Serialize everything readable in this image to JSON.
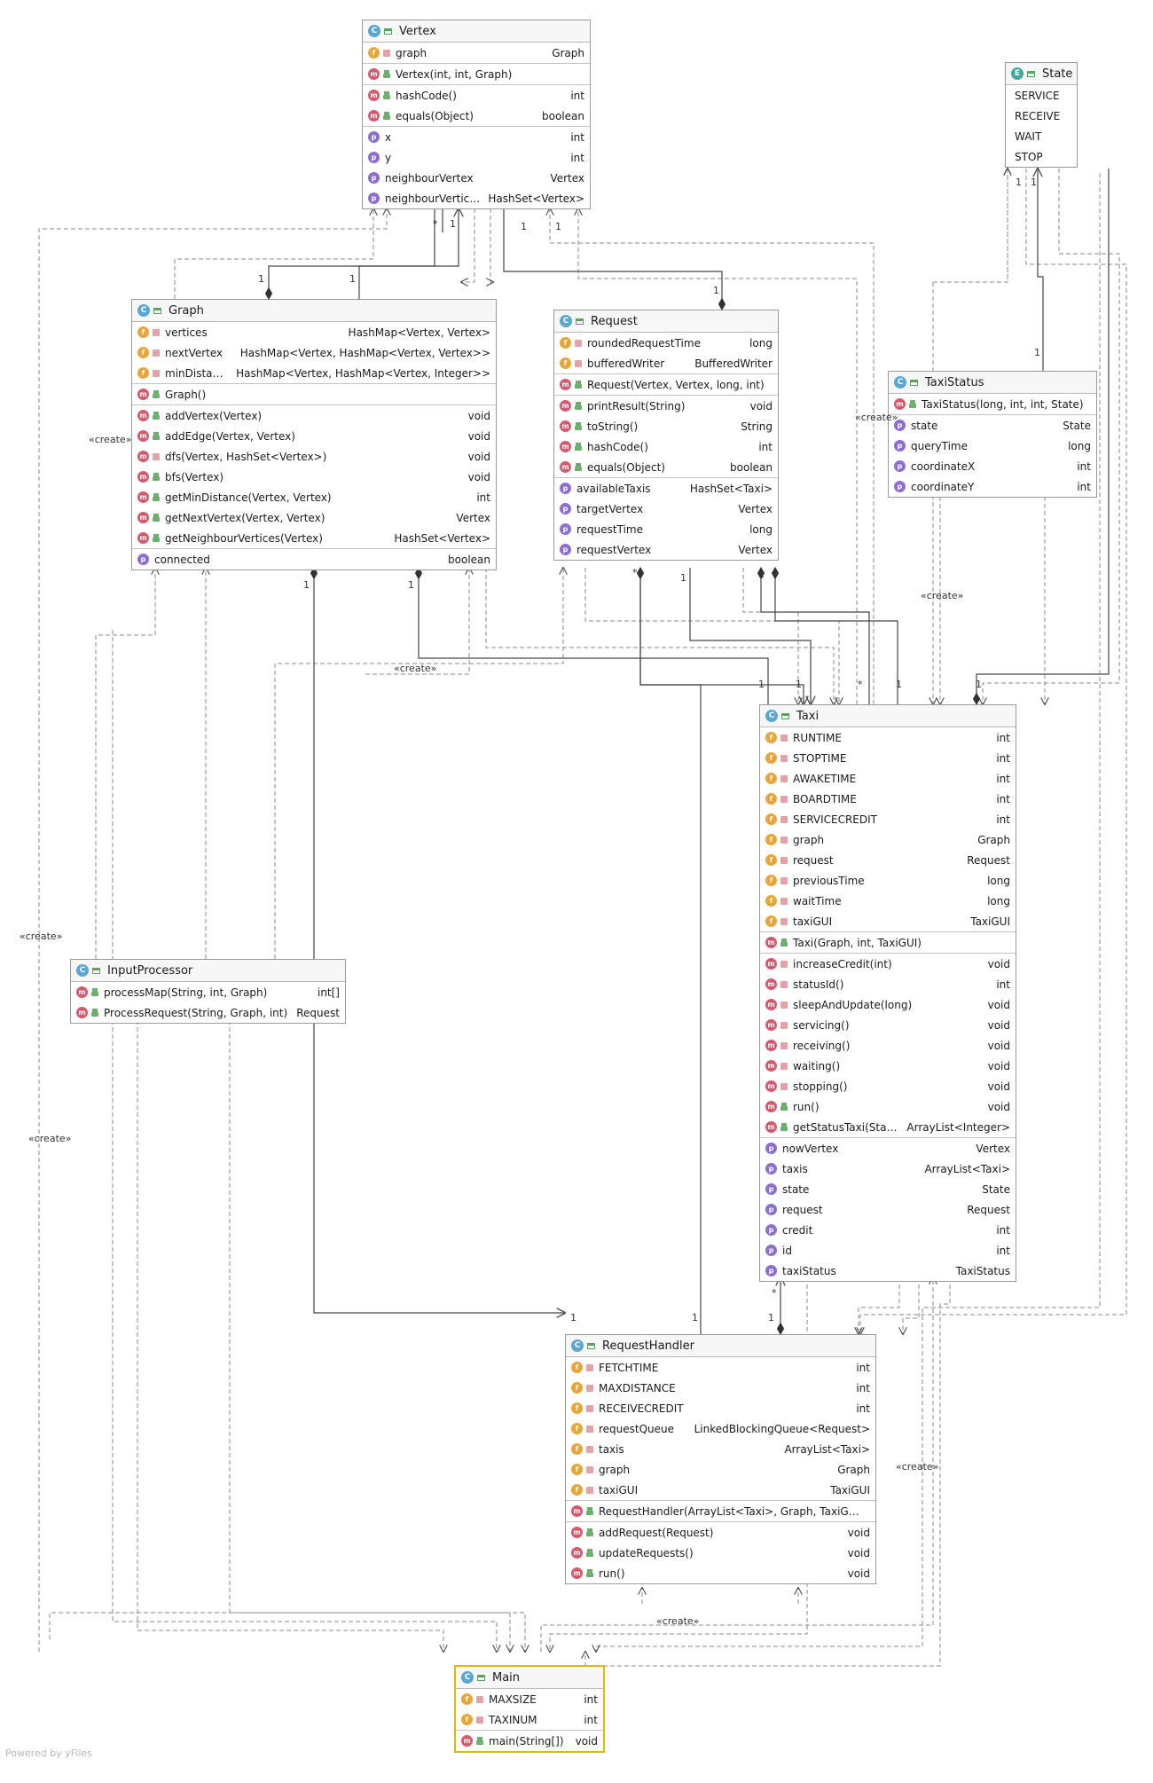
{
  "footer": "Powered by yFiles",
  "stereotype": "«create»",
  "mult_one": "1",
  "mult_many": "*",
  "classes": {
    "vertex": {
      "badge": "C",
      "name": "Vertex",
      "sections": [
        [
          {
            "k": "f",
            "v": "priv",
            "n": "graph",
            "t": "Graph"
          }
        ],
        [
          {
            "k": "m",
            "v": "pub",
            "n": "Vertex(int, int, Graph)",
            "t": ""
          }
        ],
        [
          {
            "k": "m",
            "v": "pub",
            "n": "hashCode()",
            "t": "int"
          },
          {
            "k": "m",
            "v": "pub",
            "n": "equals(Object)",
            "t": "boolean"
          }
        ],
        [
          {
            "k": "p",
            "v": "none",
            "n": "x",
            "t": "int"
          },
          {
            "k": "p",
            "v": "none",
            "n": "y",
            "t": "int"
          },
          {
            "k": "p",
            "v": "none",
            "n": "neighbourVertex",
            "t": "Vertex"
          },
          {
            "k": "p",
            "v": "none",
            "n": "neighbourVertices",
            "t": "HashSet<Vertex>"
          }
        ]
      ]
    },
    "state": {
      "badge": "E",
      "name": "State",
      "sections": [
        [
          {
            "k": "",
            "v": "",
            "n": "SERVICE",
            "t": ""
          },
          {
            "k": "",
            "v": "",
            "n": "RECEIVE",
            "t": ""
          },
          {
            "k": "",
            "v": "",
            "n": "WAIT",
            "t": ""
          },
          {
            "k": "",
            "v": "",
            "n": "STOP",
            "t": ""
          }
        ]
      ]
    },
    "graph": {
      "badge": "C",
      "name": "Graph",
      "sections": [
        [
          {
            "k": "f",
            "v": "priv",
            "n": "vertices",
            "t": "HashMap<Vertex, Vertex>"
          },
          {
            "k": "f",
            "v": "priv",
            "n": "nextVertex",
            "t": "HashMap<Vertex, HashMap<Vertex, Vertex>>"
          },
          {
            "k": "f",
            "v": "priv",
            "n": "minDistance",
            "t": "HashMap<Vertex, HashMap<Vertex, Integer>>"
          }
        ],
        [
          {
            "k": "m",
            "v": "pub",
            "n": "Graph()",
            "t": ""
          }
        ],
        [
          {
            "k": "m",
            "v": "pub",
            "n": "addVertex(Vertex)",
            "t": "void"
          },
          {
            "k": "m",
            "v": "pub",
            "n": "addEdge(Vertex, Vertex)",
            "t": "void"
          },
          {
            "k": "m",
            "v": "priv",
            "n": "dfs(Vertex, HashSet<Vertex>)",
            "t": "void"
          },
          {
            "k": "m",
            "v": "pub",
            "n": "bfs(Vertex)",
            "t": "void"
          },
          {
            "k": "m",
            "v": "pub",
            "n": "getMinDistance(Vertex, Vertex)",
            "t": "int"
          },
          {
            "k": "m",
            "v": "pub",
            "n": "getNextVertex(Vertex, Vertex)",
            "t": "Vertex"
          },
          {
            "k": "m",
            "v": "pub",
            "n": "getNeighbourVertices(Vertex)",
            "t": "HashSet<Vertex>"
          }
        ],
        [
          {
            "k": "p",
            "v": "none",
            "n": "connected",
            "t": "boolean"
          }
        ]
      ]
    },
    "request": {
      "badge": "C",
      "name": "Request",
      "sections": [
        [
          {
            "k": "f",
            "v": "priv",
            "n": "roundedRequestTime",
            "t": "long"
          },
          {
            "k": "f",
            "v": "priv",
            "n": "bufferedWriter",
            "t": "BufferedWriter"
          }
        ],
        [
          {
            "k": "m",
            "v": "pub",
            "n": "Request(Vertex, Vertex, long, int)",
            "t": ""
          }
        ],
        [
          {
            "k": "m",
            "v": "pub",
            "n": "printResult(String)",
            "t": "void"
          },
          {
            "k": "m",
            "v": "pub",
            "n": "toString()",
            "t": "String"
          },
          {
            "k": "m",
            "v": "pub",
            "n": "hashCode()",
            "t": "int"
          },
          {
            "k": "m",
            "v": "pub",
            "n": "equals(Object)",
            "t": "boolean"
          }
        ],
        [
          {
            "k": "p",
            "v": "none",
            "n": "availableTaxis",
            "t": "HashSet<Taxi>"
          },
          {
            "k": "p",
            "v": "none",
            "n": "targetVertex",
            "t": "Vertex"
          },
          {
            "k": "p",
            "v": "none",
            "n": "requestTime",
            "t": "long"
          },
          {
            "k": "p",
            "v": "none",
            "n": "requestVertex",
            "t": "Vertex"
          }
        ]
      ]
    },
    "taxistatus": {
      "badge": "C",
      "name": "TaxiStatus",
      "sections": [
        [
          {
            "k": "m",
            "v": "pub",
            "n": "TaxiStatus(long, int, int, State)",
            "t": ""
          }
        ],
        [
          {
            "k": "p",
            "v": "none",
            "n": "state",
            "t": "State"
          },
          {
            "k": "p",
            "v": "none",
            "n": "queryTime",
            "t": "long"
          },
          {
            "k": "p",
            "v": "none",
            "n": "coordinateX",
            "t": "int"
          },
          {
            "k": "p",
            "v": "none",
            "n": "coordinateY",
            "t": "int"
          }
        ]
      ]
    },
    "taxi": {
      "badge": "C",
      "name": "Taxi",
      "sections": [
        [
          {
            "k": "f",
            "v": "priv",
            "n": "RUNTIME",
            "t": "int"
          },
          {
            "k": "f",
            "v": "priv",
            "n": "STOPTIME",
            "t": "int"
          },
          {
            "k": "f",
            "v": "priv",
            "n": "AWAKETIME",
            "t": "int"
          },
          {
            "k": "f",
            "v": "priv",
            "n": "BOARDTIME",
            "t": "int"
          },
          {
            "k": "f",
            "v": "priv",
            "n": "SERVICECREDIT",
            "t": "int"
          },
          {
            "k": "f",
            "v": "priv",
            "n": "graph",
            "t": "Graph"
          },
          {
            "k": "f",
            "v": "priv",
            "n": "request",
            "t": "Request"
          },
          {
            "k": "f",
            "v": "priv",
            "n": "previousTime",
            "t": "long"
          },
          {
            "k": "f",
            "v": "priv",
            "n": "waitTime",
            "t": "long"
          },
          {
            "k": "f",
            "v": "priv",
            "n": "taxiGUI",
            "t": "TaxiGUI"
          }
        ],
        [
          {
            "k": "m",
            "v": "pub",
            "n": "Taxi(Graph, int, TaxiGUI)",
            "t": ""
          }
        ],
        [
          {
            "k": "m",
            "v": "priv",
            "n": "increaseCredit(int)",
            "t": "void"
          },
          {
            "k": "m",
            "v": "priv",
            "n": "statusId()",
            "t": "int"
          },
          {
            "k": "m",
            "v": "priv",
            "n": "sleepAndUpdate(long)",
            "t": "void"
          },
          {
            "k": "m",
            "v": "priv",
            "n": "servicing()",
            "t": "void"
          },
          {
            "k": "m",
            "v": "priv",
            "n": "receiving()",
            "t": "void"
          },
          {
            "k": "m",
            "v": "priv",
            "n": "waiting()",
            "t": "void"
          },
          {
            "k": "m",
            "v": "priv",
            "n": "stopping()",
            "t": "void"
          },
          {
            "k": "m",
            "v": "pub",
            "n": "run()",
            "t": "void"
          },
          {
            "k": "m",
            "v": "pub",
            "n": "getStatusTaxi(State)",
            "t": "ArrayList<Integer>"
          }
        ],
        [
          {
            "k": "p",
            "v": "none",
            "n": "nowVertex",
            "t": "Vertex"
          },
          {
            "k": "p",
            "v": "none",
            "n": "taxis",
            "t": "ArrayList<Taxi>"
          },
          {
            "k": "p",
            "v": "none",
            "n": "state",
            "t": "State"
          },
          {
            "k": "p",
            "v": "none",
            "n": "request",
            "t": "Request"
          },
          {
            "k": "p",
            "v": "none",
            "n": "credit",
            "t": "int"
          },
          {
            "k": "p",
            "v": "none",
            "n": "id",
            "t": "int"
          },
          {
            "k": "p",
            "v": "none",
            "n": "taxiStatus",
            "t": "TaxiStatus"
          }
        ]
      ]
    },
    "inputprocessor": {
      "badge": "C",
      "name": "InputProcessor",
      "sections": [
        [
          {
            "k": "m",
            "v": "pub",
            "n": "processMap(String, int, Graph)",
            "t": "int[]"
          },
          {
            "k": "m",
            "v": "pub",
            "n": "ProcessRequest(String, Graph, int)",
            "t": "Request"
          }
        ]
      ]
    },
    "requesthandler": {
      "badge": "C",
      "name": "RequestHandler",
      "sections": [
        [
          {
            "k": "f",
            "v": "priv",
            "n": "FETCHTIME",
            "t": "int"
          },
          {
            "k": "f",
            "v": "priv",
            "n": "MAXDISTANCE",
            "t": "int"
          },
          {
            "k": "f",
            "v": "priv",
            "n": "RECEIVECREDIT",
            "t": "int"
          },
          {
            "k": "f",
            "v": "priv",
            "n": "requestQueue",
            "t": "LinkedBlockingQueue<Request>"
          },
          {
            "k": "f",
            "v": "priv",
            "n": "taxis",
            "t": "ArrayList<Taxi>"
          },
          {
            "k": "f",
            "v": "priv",
            "n": "graph",
            "t": "Graph"
          },
          {
            "k": "f",
            "v": "priv",
            "n": "taxiGUI",
            "t": "TaxiGUI"
          }
        ],
        [
          {
            "k": "m",
            "v": "pub",
            "n": "RequestHandler(ArrayList<Taxi>, Graph, TaxiGUI)",
            "t": ""
          }
        ],
        [
          {
            "k": "m",
            "v": "pub",
            "n": "addRequest(Request)",
            "t": "void"
          },
          {
            "k": "m",
            "v": "pub",
            "n": "updateRequests()",
            "t": "void"
          },
          {
            "k": "m",
            "v": "pub",
            "n": "run()",
            "t": "void"
          }
        ]
      ]
    },
    "main": {
      "badge": "C",
      "name": "Main",
      "sections": [
        [
          {
            "k": "f",
            "v": "priv",
            "n": "MAXSIZE",
            "t": "int"
          },
          {
            "k": "f",
            "v": "priv",
            "n": "TAXINUM",
            "t": "int"
          }
        ],
        [
          {
            "k": "m",
            "v": "pub",
            "n": "main(String[])",
            "t": "void"
          }
        ]
      ]
    }
  }
}
